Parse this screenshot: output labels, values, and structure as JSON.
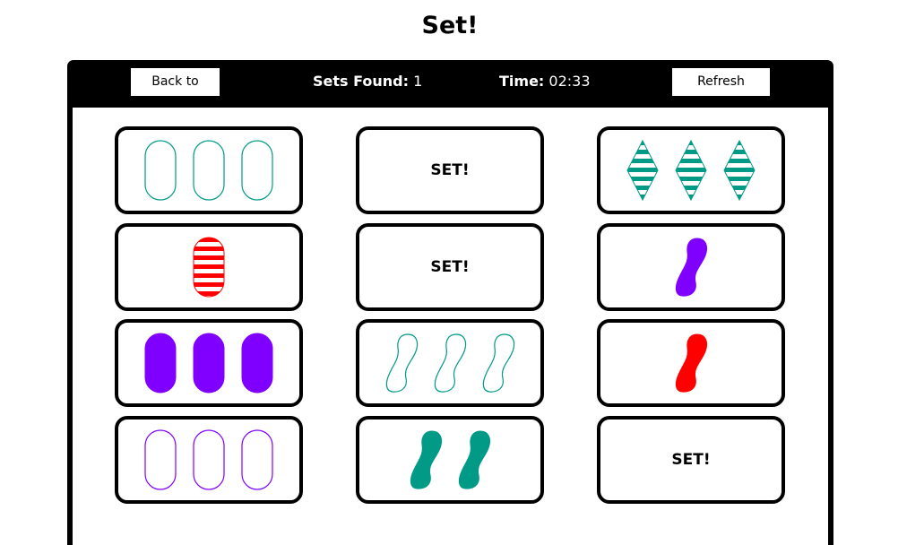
{
  "page": {
    "title": "Set!"
  },
  "header": {
    "back_label": "Back to Main",
    "sets_found_label": "Sets Found:",
    "sets_found_value": "1",
    "time_label": "Time:",
    "time_value": "02:33",
    "refresh_label": "Refresh Board"
  },
  "colors": {
    "teal": "#009a87",
    "red": "#ff0000",
    "purple": "#8000ff",
    "panel": "#000000"
  },
  "cards": [
    {
      "name": "card-r1c1",
      "found": false,
      "count": 3,
      "shape": "oval",
      "color": "teal",
      "shading": "open"
    },
    {
      "name": "card-r1c2",
      "found": true,
      "label": "SET!"
    },
    {
      "name": "card-r1c3",
      "found": false,
      "count": 3,
      "shape": "diamond",
      "color": "teal",
      "shading": "striped"
    },
    {
      "name": "card-r2c1",
      "found": false,
      "count": 1,
      "shape": "oval",
      "color": "red",
      "shading": "striped"
    },
    {
      "name": "card-r2c2",
      "found": true,
      "label": "SET!"
    },
    {
      "name": "card-r2c3",
      "found": false,
      "count": 1,
      "shape": "squiggle",
      "color": "purple",
      "shading": "solid"
    },
    {
      "name": "card-r3c1",
      "found": false,
      "count": 3,
      "shape": "oval",
      "color": "purple",
      "shading": "solid"
    },
    {
      "name": "card-r3c2",
      "found": false,
      "count": 3,
      "shape": "squiggle",
      "color": "teal",
      "shading": "open"
    },
    {
      "name": "card-r3c3",
      "found": false,
      "count": 1,
      "shape": "squiggle",
      "color": "red",
      "shading": "solid"
    },
    {
      "name": "card-r4c1",
      "found": false,
      "count": 3,
      "shape": "oval",
      "color": "purple",
      "shading": "open"
    },
    {
      "name": "card-r4c2",
      "found": false,
      "count": 2,
      "shape": "squiggle",
      "color": "teal",
      "shading": "solid"
    },
    {
      "name": "card-r4c3",
      "found": true,
      "label": "SET!"
    }
  ]
}
